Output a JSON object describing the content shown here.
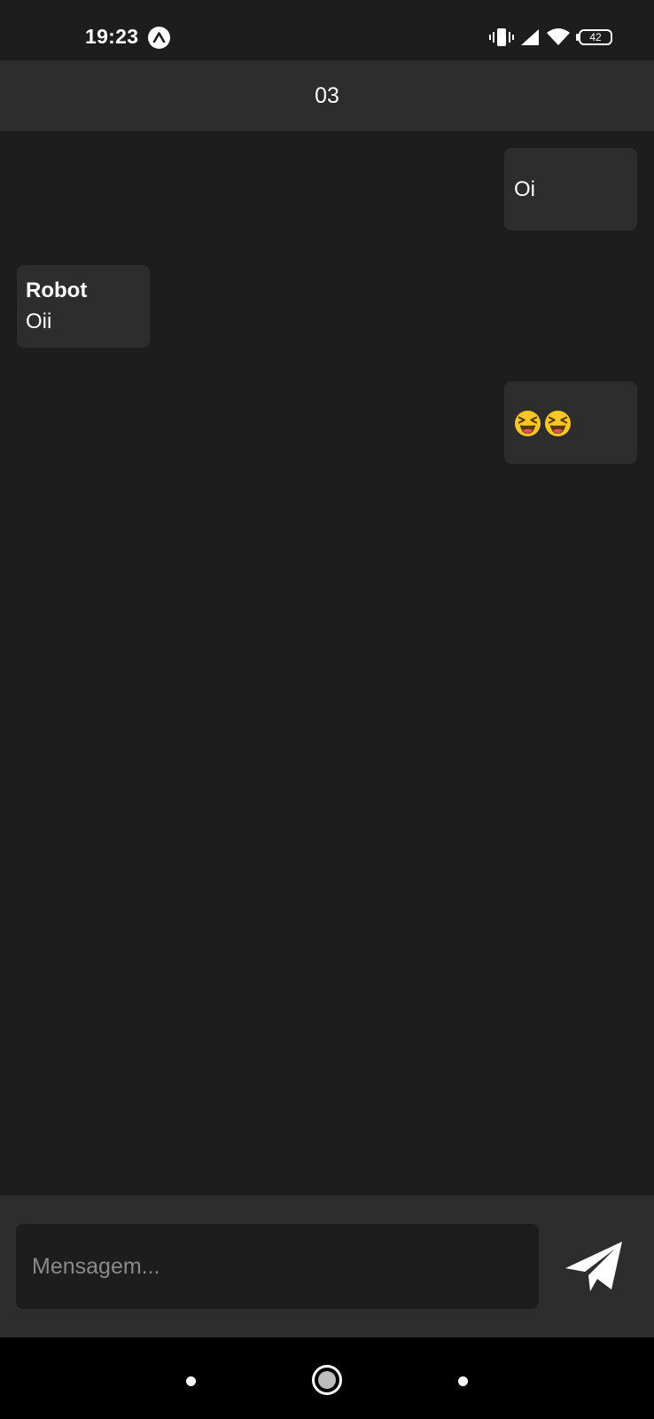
{
  "status_bar": {
    "time": "19:23",
    "battery_level": "42",
    "app_icon": "expo-icon",
    "icons": [
      "vibrate-icon",
      "signal-icon",
      "wifi-icon",
      "battery-icon"
    ]
  },
  "header": {
    "title": "03"
  },
  "messages": [
    {
      "direction": "sent",
      "text": "Oi"
    },
    {
      "direction": "received",
      "sender": "Robot",
      "text": "Oii"
    },
    {
      "direction": "sent",
      "text": "",
      "emoji": [
        "laughing-emoji",
        "laughing-emoji"
      ]
    }
  ],
  "composer": {
    "placeholder": "Mensagem...",
    "value": "",
    "send_icon": "send-icon"
  },
  "nav_bar": {
    "icons": [
      "back-icon",
      "home-icon",
      "recents-icon"
    ]
  },
  "colors": {
    "background": "#1d1d1d",
    "surface": "#2d2d2d",
    "text": "#ffffff",
    "placeholder": "#8a8a8a"
  }
}
